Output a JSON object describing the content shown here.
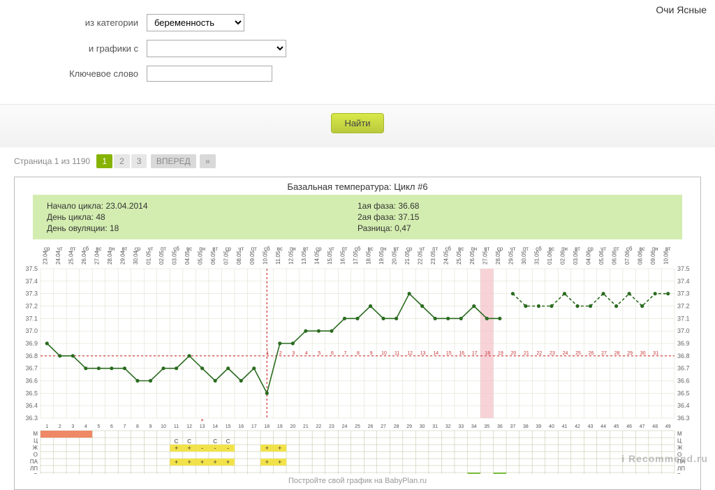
{
  "top_right": "Очи Ясные",
  "filters": {
    "category_label": "из категории",
    "category_value": "беременность",
    "graphs_label": "и графики с",
    "graphs_value": "",
    "keyword_label": "Ключевое слово",
    "keyword_value": "",
    "find_button": "Найти"
  },
  "pager": {
    "text": "Страница 1 из 1190",
    "pages": [
      "1",
      "2",
      "3"
    ],
    "active": 0,
    "next_label": "ВПЕРЕД",
    "last_label": "»"
  },
  "chart_header": {
    "title": "Базальная температура: Цикл #6",
    "left": [
      {
        "k": "Начало цикла:",
        "v": "23.04.2014"
      },
      {
        "k": "День цикла:",
        "v": "48"
      },
      {
        "k": "День овуляции:",
        "v": "18"
      }
    ],
    "right": [
      {
        "k": "1ая фаза:",
        "v": "36.68"
      },
      {
        "k": "2ая фаза:",
        "v": "37.15"
      },
      {
        "k": "Разница:",
        "v": "0,47"
      }
    ]
  },
  "chart_data": {
    "type": "line",
    "title": "Базальная температура: Цикл #6",
    "ylabel": "°C",
    "ylim": [
      36.3,
      37.5
    ],
    "yticks": [
      36.3,
      36.4,
      36.5,
      36.6,
      36.7,
      36.8,
      36.9,
      37.0,
      37.1,
      37.2,
      37.3,
      37.4,
      37.5
    ],
    "ovulation_day": 18,
    "coverline": 36.8,
    "highlight_day": 35,
    "categories": [
      {
        "dow": "ср",
        "date": "23.04"
      },
      {
        "dow": "чт",
        "date": "24.04"
      },
      {
        "dow": "пт",
        "date": "25.04"
      },
      {
        "dow": "сб",
        "date": "26.04"
      },
      {
        "dow": "вс",
        "date": "27.04"
      },
      {
        "dow": "пн",
        "date": "28.04"
      },
      {
        "dow": "вт",
        "date": "29.04"
      },
      {
        "dow": "ср",
        "date": "30.04"
      },
      {
        "dow": "чт",
        "date": "01.05"
      },
      {
        "dow": "пт",
        "date": "02.05"
      },
      {
        "dow": "сб",
        "date": "03.05"
      },
      {
        "dow": "вс",
        "date": "04.05"
      },
      {
        "dow": "пн",
        "date": "05.05"
      },
      {
        "dow": "вт",
        "date": "06.05"
      },
      {
        "dow": "ср",
        "date": "07.05"
      },
      {
        "dow": "чт",
        "date": "08.05"
      },
      {
        "dow": "пт",
        "date": "09.05"
      },
      {
        "dow": "сб",
        "date": "10.05"
      },
      {
        "dow": "вс",
        "date": "11.05"
      },
      {
        "dow": "пн",
        "date": "12.05"
      },
      {
        "dow": "вт",
        "date": "13.05"
      },
      {
        "dow": "ср",
        "date": "14.05"
      },
      {
        "dow": "чт",
        "date": "15.05"
      },
      {
        "dow": "пт",
        "date": "16.05"
      },
      {
        "dow": "сб",
        "date": "17.05"
      },
      {
        "dow": "вс",
        "date": "18.05"
      },
      {
        "dow": "пн",
        "date": "19.05"
      },
      {
        "dow": "вт",
        "date": "20.05"
      },
      {
        "dow": "ср",
        "date": "21.05"
      },
      {
        "dow": "чт",
        "date": "22.05"
      },
      {
        "dow": "пт",
        "date": "23.05"
      },
      {
        "dow": "сб",
        "date": "24.05"
      },
      {
        "dow": "вс",
        "date": "25.05"
      },
      {
        "dow": "пн",
        "date": "26.05"
      },
      {
        "dow": "вт",
        "date": "27.05"
      },
      {
        "dow": "ср",
        "date": "28.05"
      },
      {
        "dow": "чт",
        "date": "29.05"
      },
      {
        "dow": "пт",
        "date": "30.05"
      },
      {
        "dow": "сб",
        "date": "31.05"
      },
      {
        "dow": "вс",
        "date": "01.06"
      },
      {
        "dow": "пн",
        "date": "02.06"
      },
      {
        "dow": "вт",
        "date": "03.06"
      },
      {
        "dow": "ср",
        "date": "04.06"
      },
      {
        "dow": "чт",
        "date": "05.06"
      },
      {
        "dow": "пт",
        "date": "06.06"
      },
      {
        "dow": "сб",
        "date": "07.06"
      },
      {
        "dow": "вс",
        "date": "08.06"
      },
      {
        "dow": "пн",
        "date": "09.06"
      },
      {
        "dow": "вт",
        "date": "10.06"
      }
    ],
    "values": [
      36.9,
      36.8,
      36.8,
      36.7,
      36.7,
      36.7,
      36.7,
      36.6,
      36.6,
      36.7,
      36.7,
      36.8,
      36.7,
      36.6,
      36.7,
      36.6,
      36.7,
      36.5,
      36.9,
      36.9,
      37.0,
      37.0,
      37.0,
      37.1,
      37.1,
      37.2,
      37.1,
      37.1,
      37.3,
      37.2,
      37.1,
      37.1,
      37.1,
      37.2,
      37.1,
      37.1,
      37.3,
      37.2,
      37.2,
      37.2,
      37.3,
      37.2,
      37.2,
      37.3,
      37.2,
      37.3,
      37.2,
      37.3,
      37.3
    ],
    "menstruation_days": [
      1,
      2,
      3,
      4
    ],
    "intercourse_days": [
      11,
      12,
      13,
      14,
      15,
      18,
      19
    ],
    "cm_marks": {
      "11": "С",
      "12": "С",
      "14": "С",
      "15": "С"
    },
    "cp_marks": {
      "11": "+",
      "12": "+",
      "13": "-",
      "14": "-",
      "15": "-",
      "18": "+",
      "19": "+"
    },
    "bottom_row_labels": [
      "М",
      "Ц",
      "Ж",
      "О",
      "ПА",
      "ЛП",
      "Б"
    ],
    "post_ov_day_numbers": [
      1,
      2,
      3,
      4,
      5,
      6,
      7,
      8,
      9,
      10,
      11,
      12,
      13,
      14,
      15,
      16,
      17,
      18,
      19,
      20,
      21,
      22,
      23,
      24,
      25,
      26,
      27,
      28,
      29,
      30,
      31
    ]
  },
  "footer": "Постройте свой график на BabyPlan.ru",
  "watermark": "i Recommend.ru"
}
